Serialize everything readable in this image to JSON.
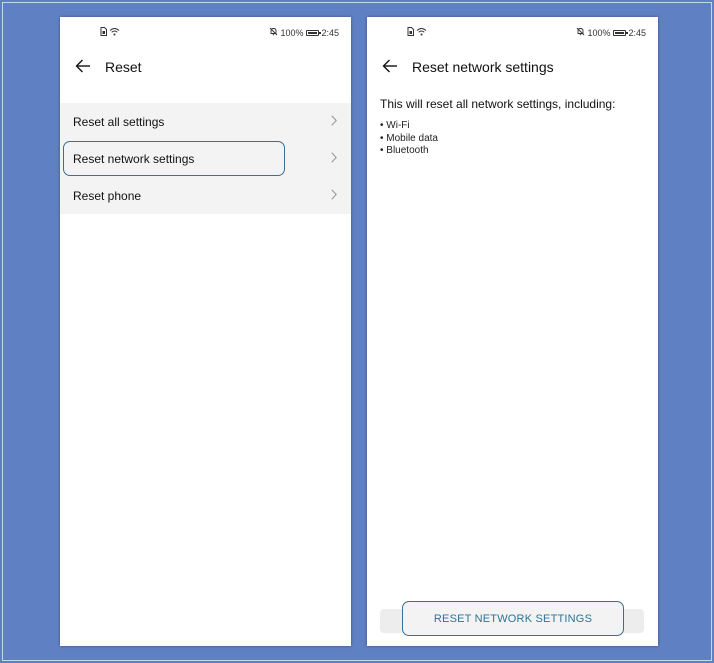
{
  "colors": {
    "background": "#6080c4",
    "highlight_border": "#3e6d92",
    "button_text": "#2c7496"
  },
  "left_screen": {
    "status_bar": {
      "icons_left": [
        "sim-card-icon",
        "wifi-icon"
      ],
      "battery": "100%",
      "time": "2:45",
      "icons_right": [
        "bell-off-icon",
        "battery-icon"
      ]
    },
    "app_bar": {
      "back_icon": "arrow-left-icon",
      "title": "Reset"
    },
    "list_items": [
      {
        "label": "Reset all settings",
        "icon": "chevron-right-icon"
      },
      {
        "label": "Reset network settings",
        "icon": "chevron-right-icon",
        "highlighted": true
      },
      {
        "label": "Reset phone",
        "icon": "chevron-right-icon"
      }
    ]
  },
  "right_screen": {
    "status_bar": {
      "icons_left": [
        "sim-card-icon",
        "wifi-icon"
      ],
      "battery": "100%",
      "time": "2:45",
      "icons_right": [
        "bell-off-icon",
        "battery-icon"
      ]
    },
    "app_bar": {
      "back_icon": "arrow-left-icon",
      "title": "Reset network settings"
    },
    "description": "This will reset all network settings, including:",
    "bullets": [
      "Wi-Fi",
      "Mobile data",
      "Bluetooth"
    ],
    "button_label": "RESET NETWORK SETTINGS"
  }
}
